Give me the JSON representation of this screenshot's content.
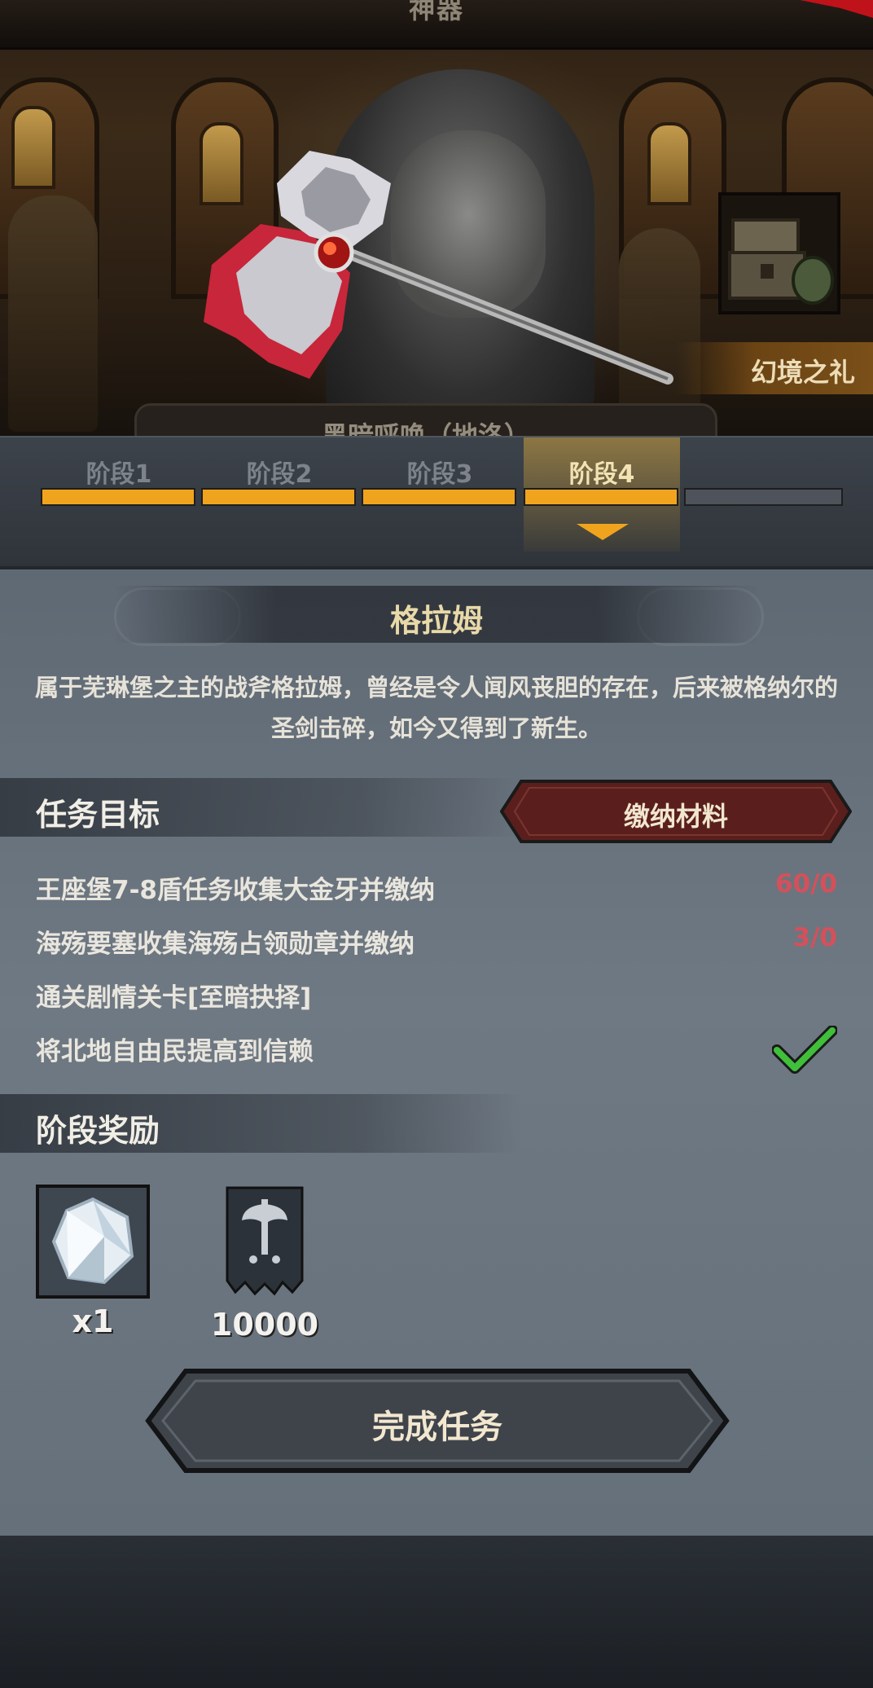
{
  "header": {
    "title": "神器"
  },
  "scene": {
    "gift_label": "幻境之礼",
    "artifact_name_partial": "黑暗呼唤（地洛）"
  },
  "stages": {
    "tabs": [
      {
        "label": "阶段1"
      },
      {
        "label": "阶段2"
      },
      {
        "label": "阶段3"
      },
      {
        "label": "阶段4"
      }
    ],
    "active_index": 3,
    "segments_filled": 4,
    "segments_total": 5
  },
  "item": {
    "name": "格拉姆",
    "description": "属于芜琳堡之主的战斧格拉姆，曾经是令人闻风丧胆的存在，后来被格纳尔的圣剑击碎，如今又得到了新生。"
  },
  "tasks": {
    "section_title": "任务目标",
    "submit_button": "缴纳材料",
    "items": [
      {
        "text": "王座堡7-8盾任务收集大金牙并缴纳",
        "count": "60/0",
        "done": false
      },
      {
        "text": "海殇要塞收集海殇占领勋章并缴纳",
        "count": "3/0",
        "done": false
      },
      {
        "text": "通关剧情关卡[至暗抉择]",
        "count": "",
        "done": false
      },
      {
        "text": "将北地自由民提高到信赖",
        "count": "",
        "done": true
      }
    ]
  },
  "rewards": {
    "section_title": "阶段奖励",
    "items": [
      {
        "icon": "crystal-icon",
        "qty": "x1"
      },
      {
        "icon": "axe-banner-icon",
        "qty": "10000"
      }
    ]
  },
  "footer": {
    "complete_button": "完成任务"
  },
  "colors": {
    "accent": "#f0a41e",
    "count_red": "#d5505a",
    "check_green": "#3fbf3a",
    "button_red": "#5a1f1c"
  }
}
